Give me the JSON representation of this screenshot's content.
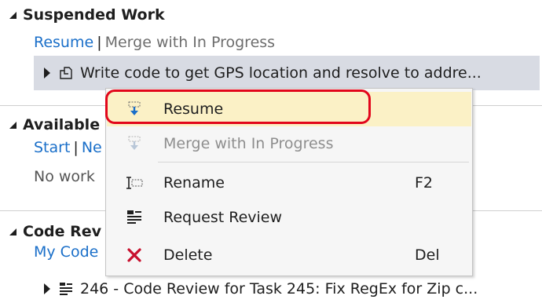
{
  "suspended": {
    "header": "Suspended Work",
    "resume_link": "Resume",
    "separator": "|",
    "merge_link": "Merge with In Progress",
    "item_label": "Write code to get GPS location and resolve to addre..."
  },
  "available": {
    "header": "Available",
    "start_link": "Start",
    "separator": "|",
    "new_link_partial": "Ne",
    "no_work_partial": "No work"
  },
  "code_review": {
    "header": "Code Rev",
    "my_code_partial": "My Code",
    "item_label": "246 - Code Review for Task 245: Fix RegEx for Zip c..."
  },
  "context_menu": {
    "items": [
      {
        "label": "Resume",
        "shortcut": "",
        "icon": "resume-icon"
      },
      {
        "label": "Merge with In Progress",
        "shortcut": "",
        "icon": "merge-icon"
      },
      {
        "label": "Rename",
        "shortcut": "F2",
        "icon": "rename-icon"
      },
      {
        "label": "Request Review",
        "shortcut": "",
        "icon": "request-review-icon"
      },
      {
        "label": "Delete",
        "shortcut": "Del",
        "icon": "delete-icon"
      }
    ]
  },
  "colors": {
    "link": "#1a6fc9",
    "selection": "#d8dbe3",
    "menu_hover": "#fbf1c6",
    "highlight": "#e2061b",
    "delete_icon": "#c8102e"
  }
}
